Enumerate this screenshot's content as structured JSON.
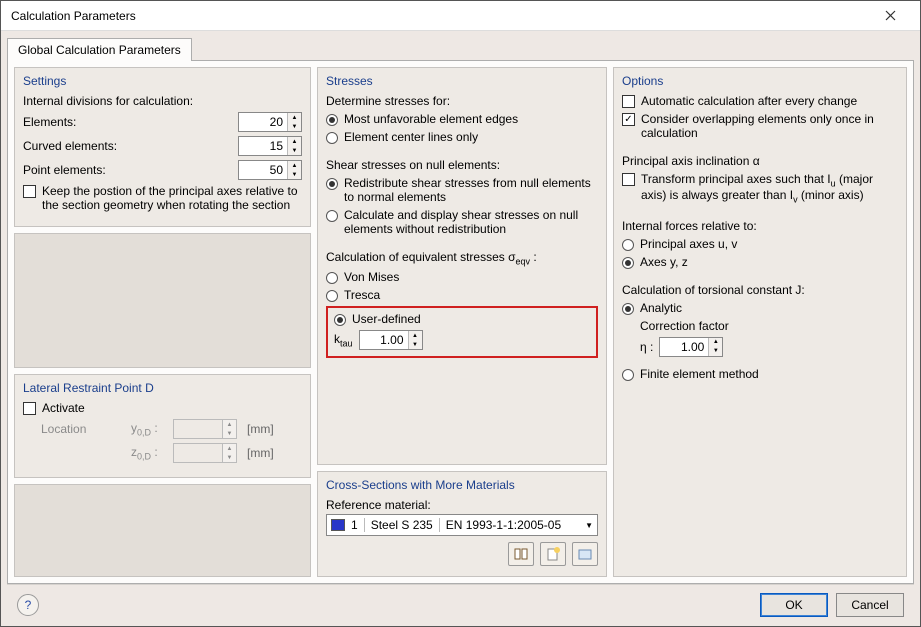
{
  "window": {
    "title": "Calculation Parameters"
  },
  "tabs": {
    "global": "Global Calculation Parameters"
  },
  "settings": {
    "title": "Settings",
    "divisions_label": "Internal divisions for calculation:",
    "elements_label": "Elements:",
    "elements_value": "20",
    "curved_label": "Curved elements:",
    "curved_value": "15",
    "point_label": "Point elements:",
    "point_value": "50",
    "keep_axes_label": "Keep the postion of the principal axes relative to the section geometry when rotating the section",
    "keep_axes_checked": false
  },
  "lateral": {
    "title": "Lateral Restraint Point D",
    "activate_label": "Activate",
    "activate_checked": false,
    "location_label": "Location",
    "y0d_label": "y0,D :",
    "z0d_label": "z0,D :",
    "unit": "[mm]"
  },
  "stresses": {
    "title": "Stresses",
    "determine_label": "Determine stresses for:",
    "opt_edges": "Most unfavorable element edges",
    "opt_center": "Element center lines only",
    "shear_null_label": "Shear stresses on null elements:",
    "opt_redist": "Redistribute shear stresses from null elements to normal elements",
    "opt_noredist": "Calculate and display shear stresses on null elements without redistribution",
    "equiv_label": "Calculation of equivalent stresses σ",
    "equiv_sub": "eqv",
    "equiv_colon": " :",
    "opt_vm": "Von Mises",
    "opt_tresca": "Tresca",
    "opt_user": "User-defined",
    "ktau_label": "ktau",
    "ktau_value": "1.00"
  },
  "cross": {
    "title": "Cross-Sections with More Materials",
    "ref_label": "Reference material:",
    "mat_no": "1",
    "mat_name": "Steel S 235",
    "mat_code": "EN 1993-1-1:2005-05"
  },
  "options": {
    "title": "Options",
    "auto_label": "Automatic calculation after every change",
    "auto_checked": false,
    "overlap_label": "Consider overlapping elements only once in calculation",
    "overlap_checked": true,
    "princ_title": "Principal axis inclination α",
    "transform_label_1": "Transform principal axes such that I",
    "transform_u": "u",
    "transform_label_2": " (major axis) is always greater than I",
    "transform_v": "v",
    "transform_label_3": " (minor axis)",
    "transform_checked": false,
    "internal_label": "Internal forces relative to:",
    "opt_uv": "Principal axes u, v",
    "opt_yz": "Axes y, z",
    "tors_title": "Calculation of torsional constant J:",
    "opt_analytic": "Analytic",
    "corr_label": "Correction factor",
    "eta_label": "η :",
    "eta_value": "1.00",
    "opt_fem": "Finite element method"
  },
  "footer": {
    "ok": "OK",
    "cancel": "Cancel"
  }
}
